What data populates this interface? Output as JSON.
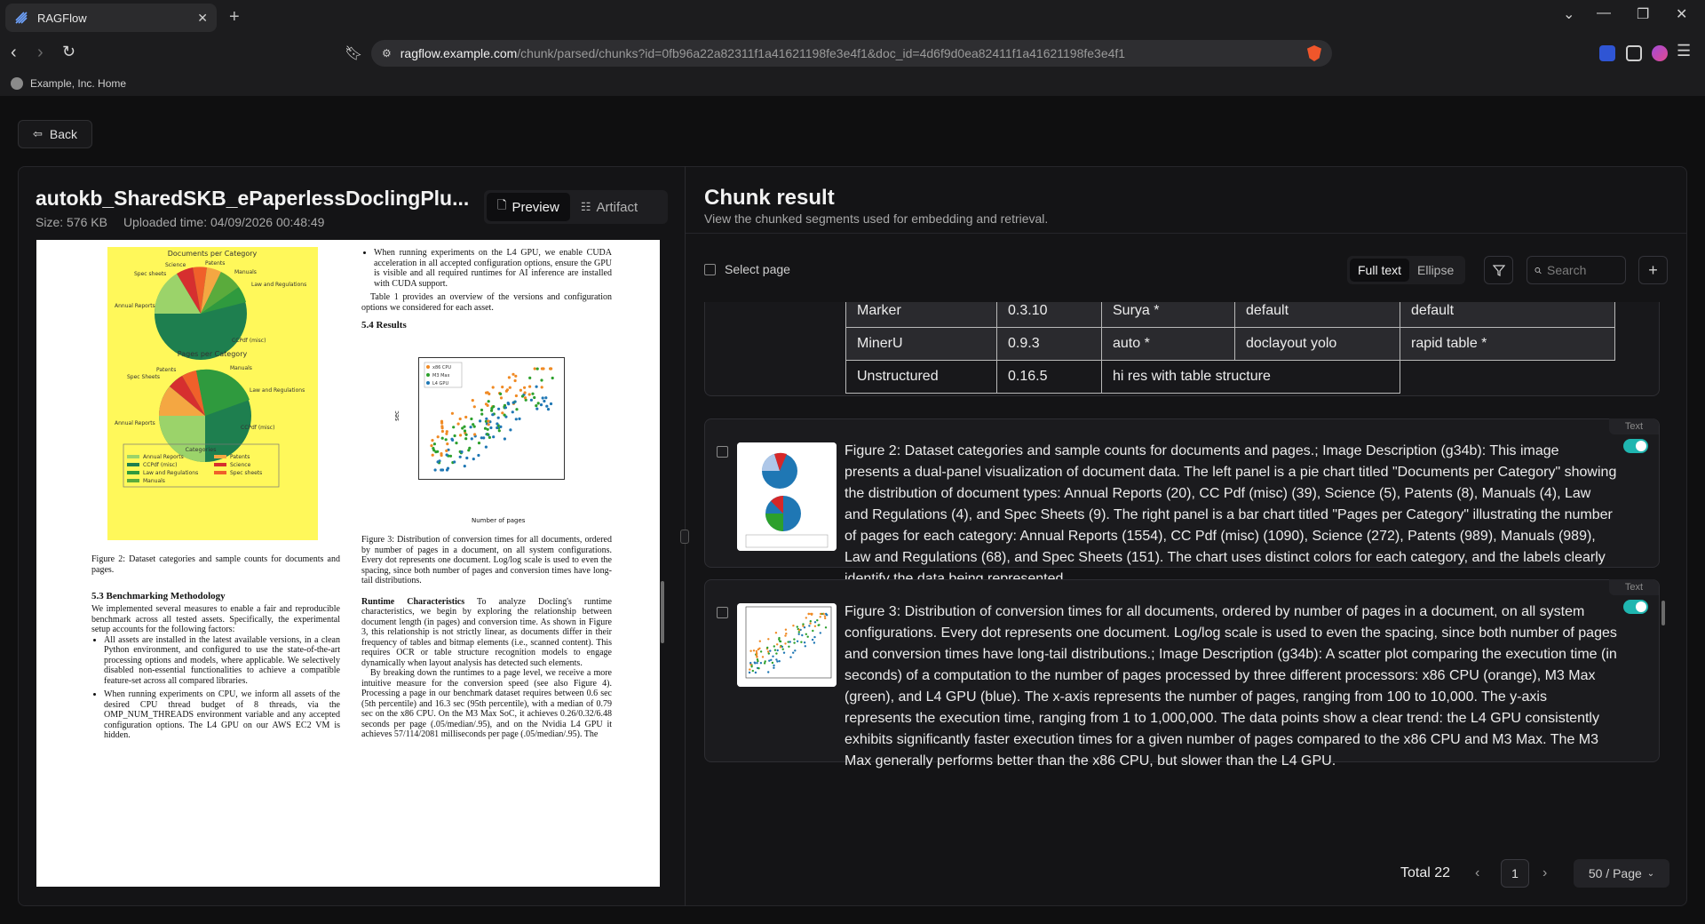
{
  "browser": {
    "tab_title": "RAGFlow",
    "new_tab": "+",
    "url_host": "ragflow.example.com",
    "url_path": "/chunk/parsed/chunks?id=0fb96a22a82311f1a41621198fe3e4f1&doc_id=4d6f9d0ea82411f1a41621198fe3e4f1",
    "bookmark": "Example, Inc. Home"
  },
  "app": {
    "back_label": "Back",
    "doc_title": "autokb_SharedSKB_ePaperlessDoclingPlu...",
    "size_label": "Size: 576 KB",
    "uploaded_label": "Uploaded time: 04/09/2026 00:48:49",
    "tabs": [
      {
        "label": "Preview",
        "active": true
      },
      {
        "label": "Artifact",
        "active": false
      }
    ]
  },
  "pdf": {
    "fig2_title_a": "Documents per Category",
    "fig2_title_b": "Pages per Category",
    "fig2_legend_title": "Categories",
    "fig2_legend": [
      "Annual Reports",
      "CCPdf (misc)",
      "Law and Regulations",
      "Manuals",
      "Patents",
      "Science",
      "Spec sheets"
    ],
    "fig2_pie1_labels": [
      "Science",
      "Patents",
      "Manuals",
      "Spec sheets",
      "Law and Regulations",
      "Annual Reports",
      "CCPdf (misc)"
    ],
    "fig2_pie2_labels": [
      "Patents",
      "Science",
      "Spec Sheets",
      "Manuals",
      "Law and Regulations",
      "Annual Reports",
      "CCPdf (misc)"
    ],
    "fig2_caption": "Figure 2: Dataset categories and sample counts for documents and pages.",
    "sec53": "5.3    Benchmarking Methodology",
    "sec53_text": "We implemented several measures to enable a fair and reproducible benchmark across all tested assets. Specifically, the experimental setup accounts for the following factors:",
    "sec53_b1": "All assets are installed in the latest available versions, in a clean Python environment, and configured to use the state-of-the-art processing options and models, where applicable. We selectively disabled non-essential functionalities to achieve a compatible feature-set across all compared libraries.",
    "sec53_b2": "When running experiments on CPU, we inform all assets of the desired CPU thread budget of 8 threads, via the OMP_NUM_THREADS environment variable and any accepted configuration options. The L4 GPU on our AWS EC2 VM is hidden.",
    "col2_b": "When running experiments on the L4 GPU, we enable CUDA acceleration in all accepted configuration options, ensure the GPU is visible and all required runtimes for AI inference are installed with CUDA support.",
    "col2_p": "Table 1 provides an overview of the versions and configuration options we considered for each asset.",
    "sec54": "5.4    Results",
    "scatter_legend": [
      "x86 CPU",
      "M3 Max",
      "L4 GPU"
    ],
    "scatter_xlabel": "Number of pages",
    "scatter_ylabel": "sec",
    "fig3_caption": "Figure 3: Distribution of conversion times for all documents, ordered by number of pages in a document, on all system configurations. Every dot represents one document. Log/log scale is used to even the spacing, since both number of pages and conversion times have long-tail distributions.",
    "runtime_head": "Runtime Characteristics",
    "runtime_text": "To analyze Docling's runtime characteristics, we begin by exploring the relationship between document length (in pages) and conversion time. As shown in Figure 3, this relationship is not strictly linear, as documents differ in their frequency of tables and bitmap elements (i.e., scanned content). This requires OCR or table structure recognition models to engage dynamically when layout analysis has detected such elements.",
    "runtime_text2": "By breaking down the runtimes to a page level, we receive a more intuitive measure for the conversion speed (see also Figure 4). Processing a page in our benchmark dataset requires between 0.6 sec (5th percentile) and 16.3 sec (95th percentile), with a median of 0.79 sec on the x86 CPU. On the M3 Max SoC, it achieves 0.26/0.32/6.48 seconds per page (.05/median/.95), and on the Nvidia L4 GPU it achieves 57/114/2081 milliseconds per page (.05/median/.95). The"
  },
  "chunks": {
    "title": "Chunk result",
    "subtitle": "View the chunked segments used for embedding and retrieval.",
    "select_page": "Select page",
    "view_modes": [
      {
        "label": "Full text",
        "active": true
      },
      {
        "label": "Ellipse",
        "active": false
      }
    ],
    "search_placeholder": "Search",
    "table_rows": [
      [
        "Marker",
        "0.3.10",
        "Surya *",
        "default",
        "default"
      ],
      [
        "MinerU",
        "0.9.3",
        "auto *",
        "doclayout yolo",
        "rapid table *"
      ],
      [
        "Unstructured",
        "0.16.5",
        "hi res with table structure",
        "",
        ""
      ]
    ],
    "items": [
      {
        "tag": "Text",
        "text": "Figure 2: Dataset categories and sample counts for documents and pages.; Image Description (g34b): This image presents a dual-panel visualization of document data. The left panel is a pie chart titled \"Documents per Category\" showing the distribution of document types: Annual Reports (20), CC Pdf (misc) (39), Science (5), Patents (8), Manuals (4), Law and Regulations (4), and Spec Sheets (9). The right panel is a bar chart titled \"Pages per Category\" illustrating the number of pages for each category: Annual Reports (1554), CC Pdf (misc) (1090), Science (272), Patents (989), Manuals (989), Law and Regulations (68), and Spec Sheets (151). The chart uses distinct colors for each category, and the labels clearly identify the data being represented."
      },
      {
        "tag": "Text",
        "text": "Figure 3: Distribution of conversion times for all documents, ordered by number of pages in a document, on all system configurations. Every dot represents one document. Log/log scale is used to even the spacing, since both number of pages and conversion times have long-tail distributions.; Image Description (g34b): A scatter plot comparing the execution time (in seconds) of a computation to the number of pages processed by three different processors: x86 CPU (orange), M3 Max (green), and L4 GPU (blue). The x-axis represents the number of pages, ranging from 100 to 10,000. The y-axis represents the execution time, ranging from 1 to 1,000,000. The data points show a clear trend: the L4 GPU consistently exhibits significantly faster execution times for a given number of pages compared to the x86 CPU and M3 Max. The M3 Max generally performs better than the x86 CPU, but slower than the L4 GPU."
      }
    ],
    "pagination": {
      "total_label": "Total 22",
      "current_page": "1",
      "page_size": "50 / Page"
    }
  },
  "colors": {
    "accent": "#1fb6b0",
    "x86_cpu": "#f08a24",
    "m3_max": "#2ca02c",
    "l4_gpu": "#1f77b4"
  }
}
